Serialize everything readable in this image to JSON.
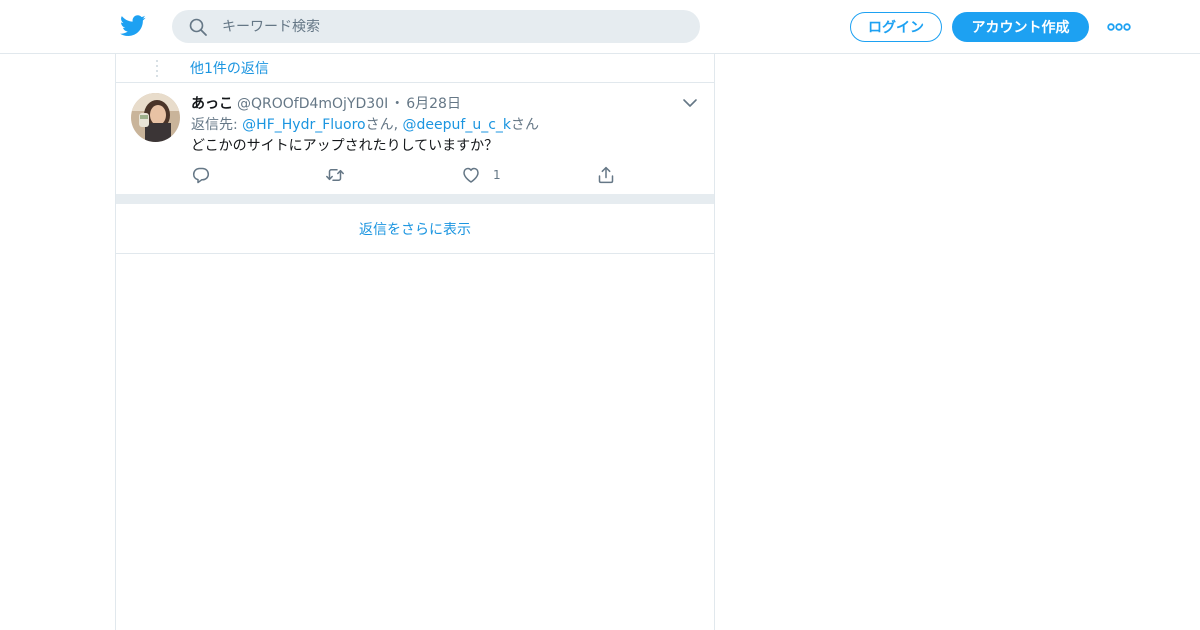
{
  "header": {
    "logo_icon": "twitter-bird-icon",
    "search": {
      "placeholder": "キーワード検索",
      "icon": "search-icon"
    },
    "login_label": "ログイン",
    "signup_label": "アカウント作成",
    "more_icon": "more-dots-icon"
  },
  "thread": {
    "more_replies_label": "他1件の返信",
    "tweet": {
      "display_name": "あっこ",
      "handle": "@QROOfD4mOjYD30I",
      "separator": "・",
      "date": "6月28日",
      "reply_prefix": "返信先: ",
      "mentions": [
        "@HF_Hydr_Fluoro",
        "@deepuf_u_c_k"
      ],
      "mention_suffix": "さん",
      "mention_joiner": ", ",
      "text": "どこかのサイトにアップされたりしていますか？",
      "actions": {
        "reply_icon": "reply-icon",
        "retweet_icon": "retweet-icon",
        "like_icon": "heart-icon",
        "like_count": "1",
        "share_icon": "share-icon"
      }
    },
    "show_more_label": "返信をさらに表示"
  },
  "colors": {
    "brand": "#1da1f2",
    "link": "#1b95e0",
    "muted": "#657786",
    "border": "#e1e8ed",
    "search_bg": "#e6ecf0"
  }
}
